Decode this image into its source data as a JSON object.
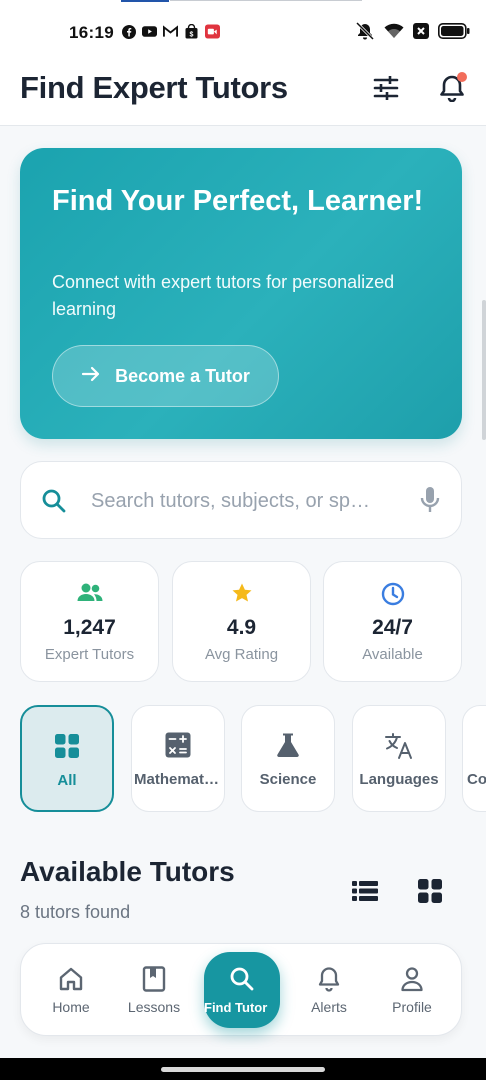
{
  "status_bar": {
    "time": "16:19",
    "left_icons": [
      "facebook-icon",
      "youtube-icon",
      "gmail-icon",
      "shopping-bag-icon",
      "video-icon"
    ],
    "right_icons": [
      "mute-icon",
      "wifi-icon",
      "close-box-icon",
      "battery-icon"
    ]
  },
  "header": {
    "title": "Find Expert Tutors",
    "filter_icon": "tune-icon",
    "notification_icon": "bell-icon",
    "notification_dot_color": "#f26d5b"
  },
  "hero": {
    "title": "Find Your Perfect, Learner!",
    "subtitle": "Connect with expert tutors for personalized learning",
    "button_label": "Become a Tutor",
    "button_icon": "arrow-right-icon",
    "color": "#1ba3af"
  },
  "search": {
    "placeholder": "Search tutors, subjects, or sp…",
    "value": "",
    "search_icon": "search-icon",
    "mic_icon": "mic-icon"
  },
  "stats": [
    {
      "value": "1,247",
      "label": "Expert Tutors",
      "icon": "people-icon",
      "color": "#2fb27a"
    },
    {
      "value": "4.9",
      "label": "Avg Rating",
      "icon": "star-icon",
      "color": "#f5b91a"
    },
    {
      "value": "24/7",
      "label": "Available",
      "icon": "clock-icon",
      "color": "#3a7de0"
    }
  ],
  "categories": [
    {
      "label": "All",
      "icon": "grid-icon",
      "active": true
    },
    {
      "label": "Mathematics",
      "icon": "calculator-icon",
      "active": false
    },
    {
      "label": "Science",
      "icon": "flask-icon",
      "active": false
    },
    {
      "label": "Languages",
      "icon": "translate-icon",
      "active": false
    },
    {
      "label": "Co",
      "icon": "code-icon",
      "active": false
    }
  ],
  "tutors_section": {
    "title": "Available Tutors",
    "count_text": "8 tutors found",
    "list_view_icon": "list-icon",
    "grid_view_icon": "grid-view-icon"
  },
  "bottom_nav": [
    {
      "label": "Home",
      "icon": "home-icon",
      "active": false
    },
    {
      "label": "Lessons",
      "icon": "book-icon",
      "active": false
    },
    {
      "label": "Find Tutor",
      "icon": "search-icon",
      "active": true
    },
    {
      "label": "Alerts",
      "icon": "bell-icon",
      "active": false
    },
    {
      "label": "Profile",
      "icon": "person-icon",
      "active": false
    }
  ],
  "accent_color": "#168e99"
}
